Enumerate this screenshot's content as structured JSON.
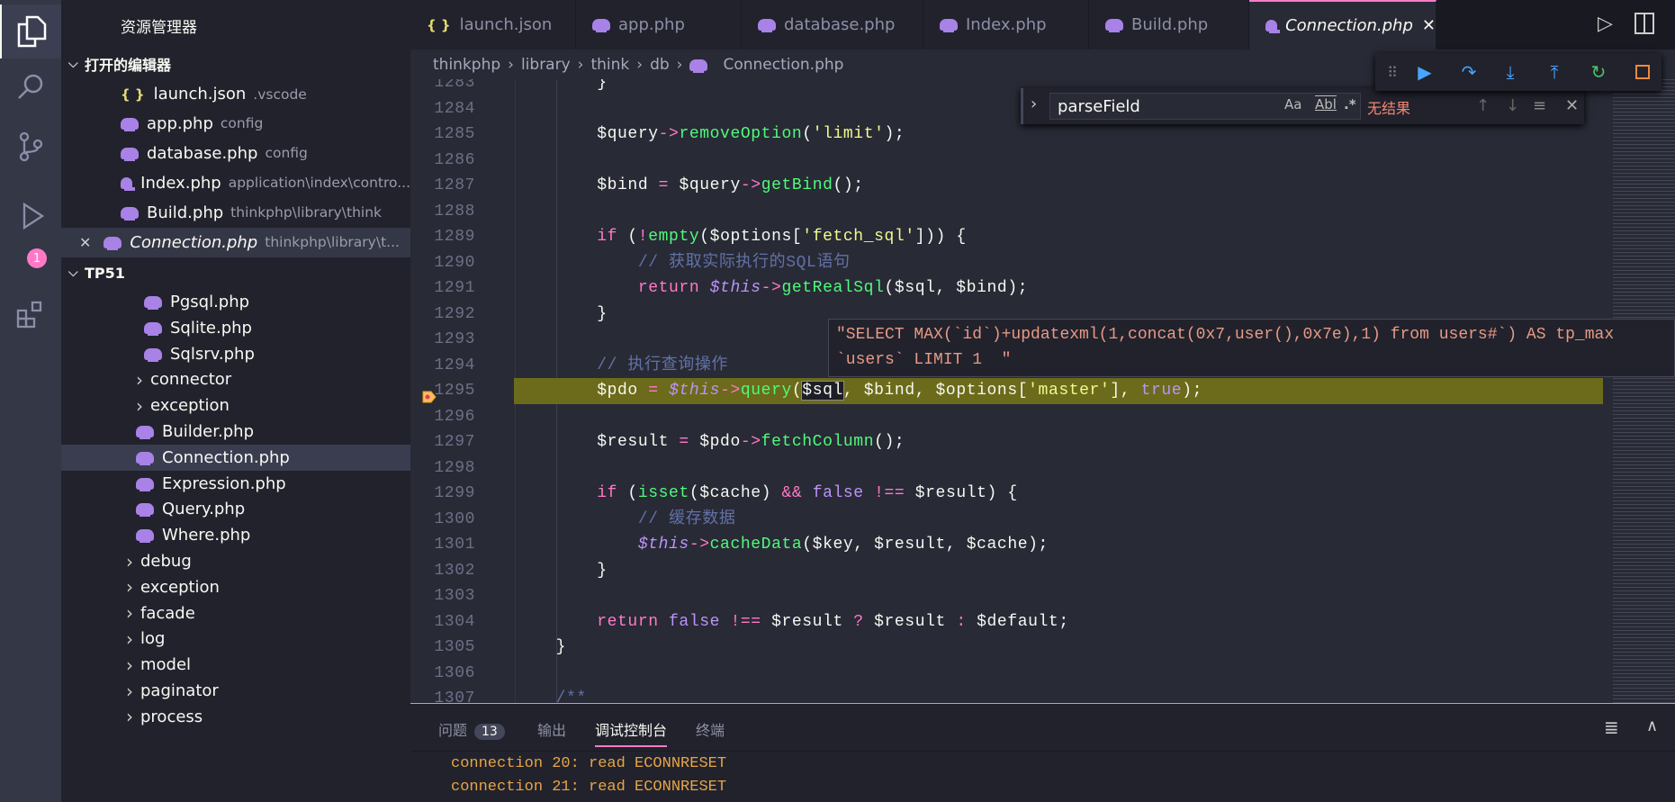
{
  "sidebar": {
    "title": "资源管理器",
    "open_editors": {
      "label": "打开的编辑器",
      "items": [
        {
          "name": "launch.json",
          "desc": ".vscode",
          "icon": "json-icon"
        },
        {
          "name": "app.php",
          "desc": "config",
          "icon": "php-icon"
        },
        {
          "name": "database.php",
          "desc": "config",
          "icon": "php-icon"
        },
        {
          "name": "Index.php",
          "desc": "application\\index\\contro...",
          "icon": "php-icon"
        },
        {
          "name": "Build.php",
          "desc": "thinkphp\\library\\think",
          "icon": "php-icon"
        },
        {
          "name": "Connection.php",
          "desc": "thinkphp\\library\\t...",
          "icon": "php-icon",
          "active": true
        }
      ]
    },
    "project": {
      "label": "TP51",
      "items": [
        {
          "name": "Pgsql.php",
          "type": "file",
          "depth": 3
        },
        {
          "name": "Sqlite.php",
          "type": "file",
          "depth": 3
        },
        {
          "name": "Sqlsrv.php",
          "type": "file",
          "depth": 3
        },
        {
          "name": "connector",
          "type": "folder",
          "depth": 2
        },
        {
          "name": "exception",
          "type": "folder",
          "depth": 2
        },
        {
          "name": "Builder.php",
          "type": "file",
          "depth": 2
        },
        {
          "name": "Connection.php",
          "type": "file",
          "depth": 2,
          "selected": true
        },
        {
          "name": "Expression.php",
          "type": "file",
          "depth": 2
        },
        {
          "name": "Query.php",
          "type": "file",
          "depth": 2
        },
        {
          "name": "Where.php",
          "type": "file",
          "depth": 2
        },
        {
          "name": "debug",
          "type": "folder",
          "depth": 1
        },
        {
          "name": "exception",
          "type": "folder",
          "depth": 1
        },
        {
          "name": "facade",
          "type": "folder",
          "depth": 1
        },
        {
          "name": "log",
          "type": "folder",
          "depth": 1
        },
        {
          "name": "model",
          "type": "folder",
          "depth": 1
        },
        {
          "name": "paginator",
          "type": "folder",
          "depth": 1
        },
        {
          "name": "process",
          "type": "folder",
          "depth": 1
        }
      ]
    }
  },
  "activity_bar": {
    "debug_badge": "1"
  },
  "tabs": [
    {
      "label": "launch.json",
      "icon": "json-icon"
    },
    {
      "label": "app.php",
      "icon": "php-icon"
    },
    {
      "label": "database.php",
      "icon": "php-icon"
    },
    {
      "label": "Index.php",
      "icon": "php-icon"
    },
    {
      "label": "Build.php",
      "icon": "php-icon"
    },
    {
      "label": "Connection.php",
      "icon": "php-icon",
      "active": true
    }
  ],
  "breadcrumb": [
    "thinkphp",
    "library",
    "think",
    "db",
    "Connection.php"
  ],
  "find": {
    "value": "parseField",
    "match_case": "Aa",
    "whole_word": "Abl",
    "regex": ".*",
    "result": "无结果",
    "result_color": "#f48771"
  },
  "hover_tooltip": "\"SELECT MAX(`id`)+updatexml(1,concat(0x7,user(),0x7e),1) from users#`) AS tp_max\n`users` LIMIT 1  \"",
  "editor": {
    "current_line": 1295,
    "lines": [
      {
        "n": 1283,
        "t": [
          [
            "        ",
            ""
          ],
          [
            "}",
            "var"
          ]
        ]
      },
      {
        "n": 1284,
        "t": []
      },
      {
        "n": 1285,
        "t": [
          [
            "        ",
            ""
          ],
          [
            "$query",
            "var"
          ],
          [
            "->",
            "op"
          ],
          [
            "removeOption",
            "fn"
          ],
          [
            "(",
            "var"
          ],
          [
            "'limit'",
            "str"
          ],
          [
            ");",
            "var"
          ]
        ]
      },
      {
        "n": 1286,
        "t": []
      },
      {
        "n": 1287,
        "t": [
          [
            "        ",
            ""
          ],
          [
            "$bind",
            "var"
          ],
          [
            " = ",
            "op"
          ],
          [
            "$query",
            "var"
          ],
          [
            "->",
            "op"
          ],
          [
            "getBind",
            "fn"
          ],
          [
            "();",
            "var"
          ]
        ]
      },
      {
        "n": 1288,
        "t": []
      },
      {
        "n": 1289,
        "t": [
          [
            "        ",
            ""
          ],
          [
            "if",
            "kw"
          ],
          [
            " (",
            "var"
          ],
          [
            "!",
            "op"
          ],
          [
            "empty",
            "fn"
          ],
          [
            "($options[",
            "var"
          ],
          [
            "'fetch_sql'",
            "str"
          ],
          [
            "])) {",
            "var"
          ]
        ]
      },
      {
        "n": 1290,
        "t": [
          [
            "            ",
            ""
          ],
          [
            "// 获取实际执行的SQL语句",
            "cmt"
          ]
        ]
      },
      {
        "n": 1291,
        "t": [
          [
            "            ",
            ""
          ],
          [
            "return ",
            "kw"
          ],
          [
            "$this",
            "this"
          ],
          [
            "->",
            "op"
          ],
          [
            "getRealSql",
            "fn"
          ],
          [
            "($sql, $bind);",
            "var"
          ]
        ]
      },
      {
        "n": 1292,
        "t": [
          [
            "        ",
            ""
          ],
          [
            "}",
            "var"
          ]
        ]
      },
      {
        "n": 1293,
        "t": []
      },
      {
        "n": 1294,
        "t": [
          [
            "        ",
            ""
          ],
          [
            "// 执行查询操作",
            "cmt"
          ]
        ]
      },
      {
        "n": 1295,
        "t": [
          [
            "        ",
            ""
          ],
          [
            "$pdo",
            "var"
          ],
          [
            " = ",
            "op"
          ],
          [
            "$this",
            "this"
          ],
          [
            "->",
            "op"
          ],
          [
            "query",
            "fn"
          ],
          [
            "(",
            "var"
          ],
          [
            "$sql",
            "sel"
          ],
          [
            ", $bind, $options[",
            "var"
          ],
          [
            "'master'",
            "str"
          ],
          [
            "], ",
            "var"
          ],
          [
            "true",
            "bool"
          ],
          [
            ");",
            "var"
          ]
        ]
      },
      {
        "n": 1296,
        "t": []
      },
      {
        "n": 1297,
        "t": [
          [
            "        ",
            ""
          ],
          [
            "$result",
            "var"
          ],
          [
            " = ",
            "op"
          ],
          [
            "$pdo",
            "var"
          ],
          [
            "->",
            "op"
          ],
          [
            "fetchColumn",
            "fn"
          ],
          [
            "();",
            "var"
          ]
        ]
      },
      {
        "n": 1298,
        "t": []
      },
      {
        "n": 1299,
        "t": [
          [
            "        ",
            ""
          ],
          [
            "if",
            "kw"
          ],
          [
            " (",
            "var"
          ],
          [
            "isset",
            "fn"
          ],
          [
            "($cache) ",
            "var"
          ],
          [
            "&&",
            "op"
          ],
          [
            " ",
            "var"
          ],
          [
            "false",
            "bool"
          ],
          [
            " !== ",
            "op"
          ],
          [
            "$result) {",
            "var"
          ]
        ]
      },
      {
        "n": 1300,
        "t": [
          [
            "            ",
            ""
          ],
          [
            "// 缓存数据",
            "cmt"
          ]
        ]
      },
      {
        "n": 1301,
        "t": [
          [
            "            ",
            ""
          ],
          [
            "$this",
            "this"
          ],
          [
            "->",
            "op"
          ],
          [
            "cacheData",
            "fn"
          ],
          [
            "($key, $result, $cache);",
            "var"
          ]
        ]
      },
      {
        "n": 1302,
        "t": [
          [
            "        ",
            ""
          ],
          [
            "}",
            "var"
          ]
        ]
      },
      {
        "n": 1303,
        "t": []
      },
      {
        "n": 1304,
        "t": [
          [
            "        ",
            ""
          ],
          [
            "return ",
            "kw"
          ],
          [
            "false",
            "bool"
          ],
          [
            " !== ",
            "op"
          ],
          [
            "$result ",
            "var"
          ],
          [
            "?",
            "op"
          ],
          [
            " $result ",
            "var"
          ],
          [
            ":",
            "op"
          ],
          [
            " $default;",
            "var"
          ]
        ]
      },
      {
        "n": 1305,
        "t": [
          [
            "    ",
            ""
          ],
          [
            "}",
            "var"
          ]
        ]
      },
      {
        "n": 1306,
        "t": []
      },
      {
        "n": 1307,
        "t": [
          [
            "    ",
            ""
          ],
          [
            "/**",
            "cmt"
          ]
        ]
      }
    ]
  },
  "panel": {
    "tabs": [
      {
        "label": "问题",
        "badge": "13"
      },
      {
        "label": "输出"
      },
      {
        "label": "调试控制台",
        "active": true
      },
      {
        "label": "终端"
      }
    ],
    "console": [
      "connection 20: read ECONNRESET",
      "connection 21: read ECONNRESET"
    ]
  },
  "colors": {
    "accent": "#ff79c6",
    "editor_bg": "#282a36",
    "sidebar_bg": "#21222c",
    "current_line": "#6b6b1b"
  }
}
